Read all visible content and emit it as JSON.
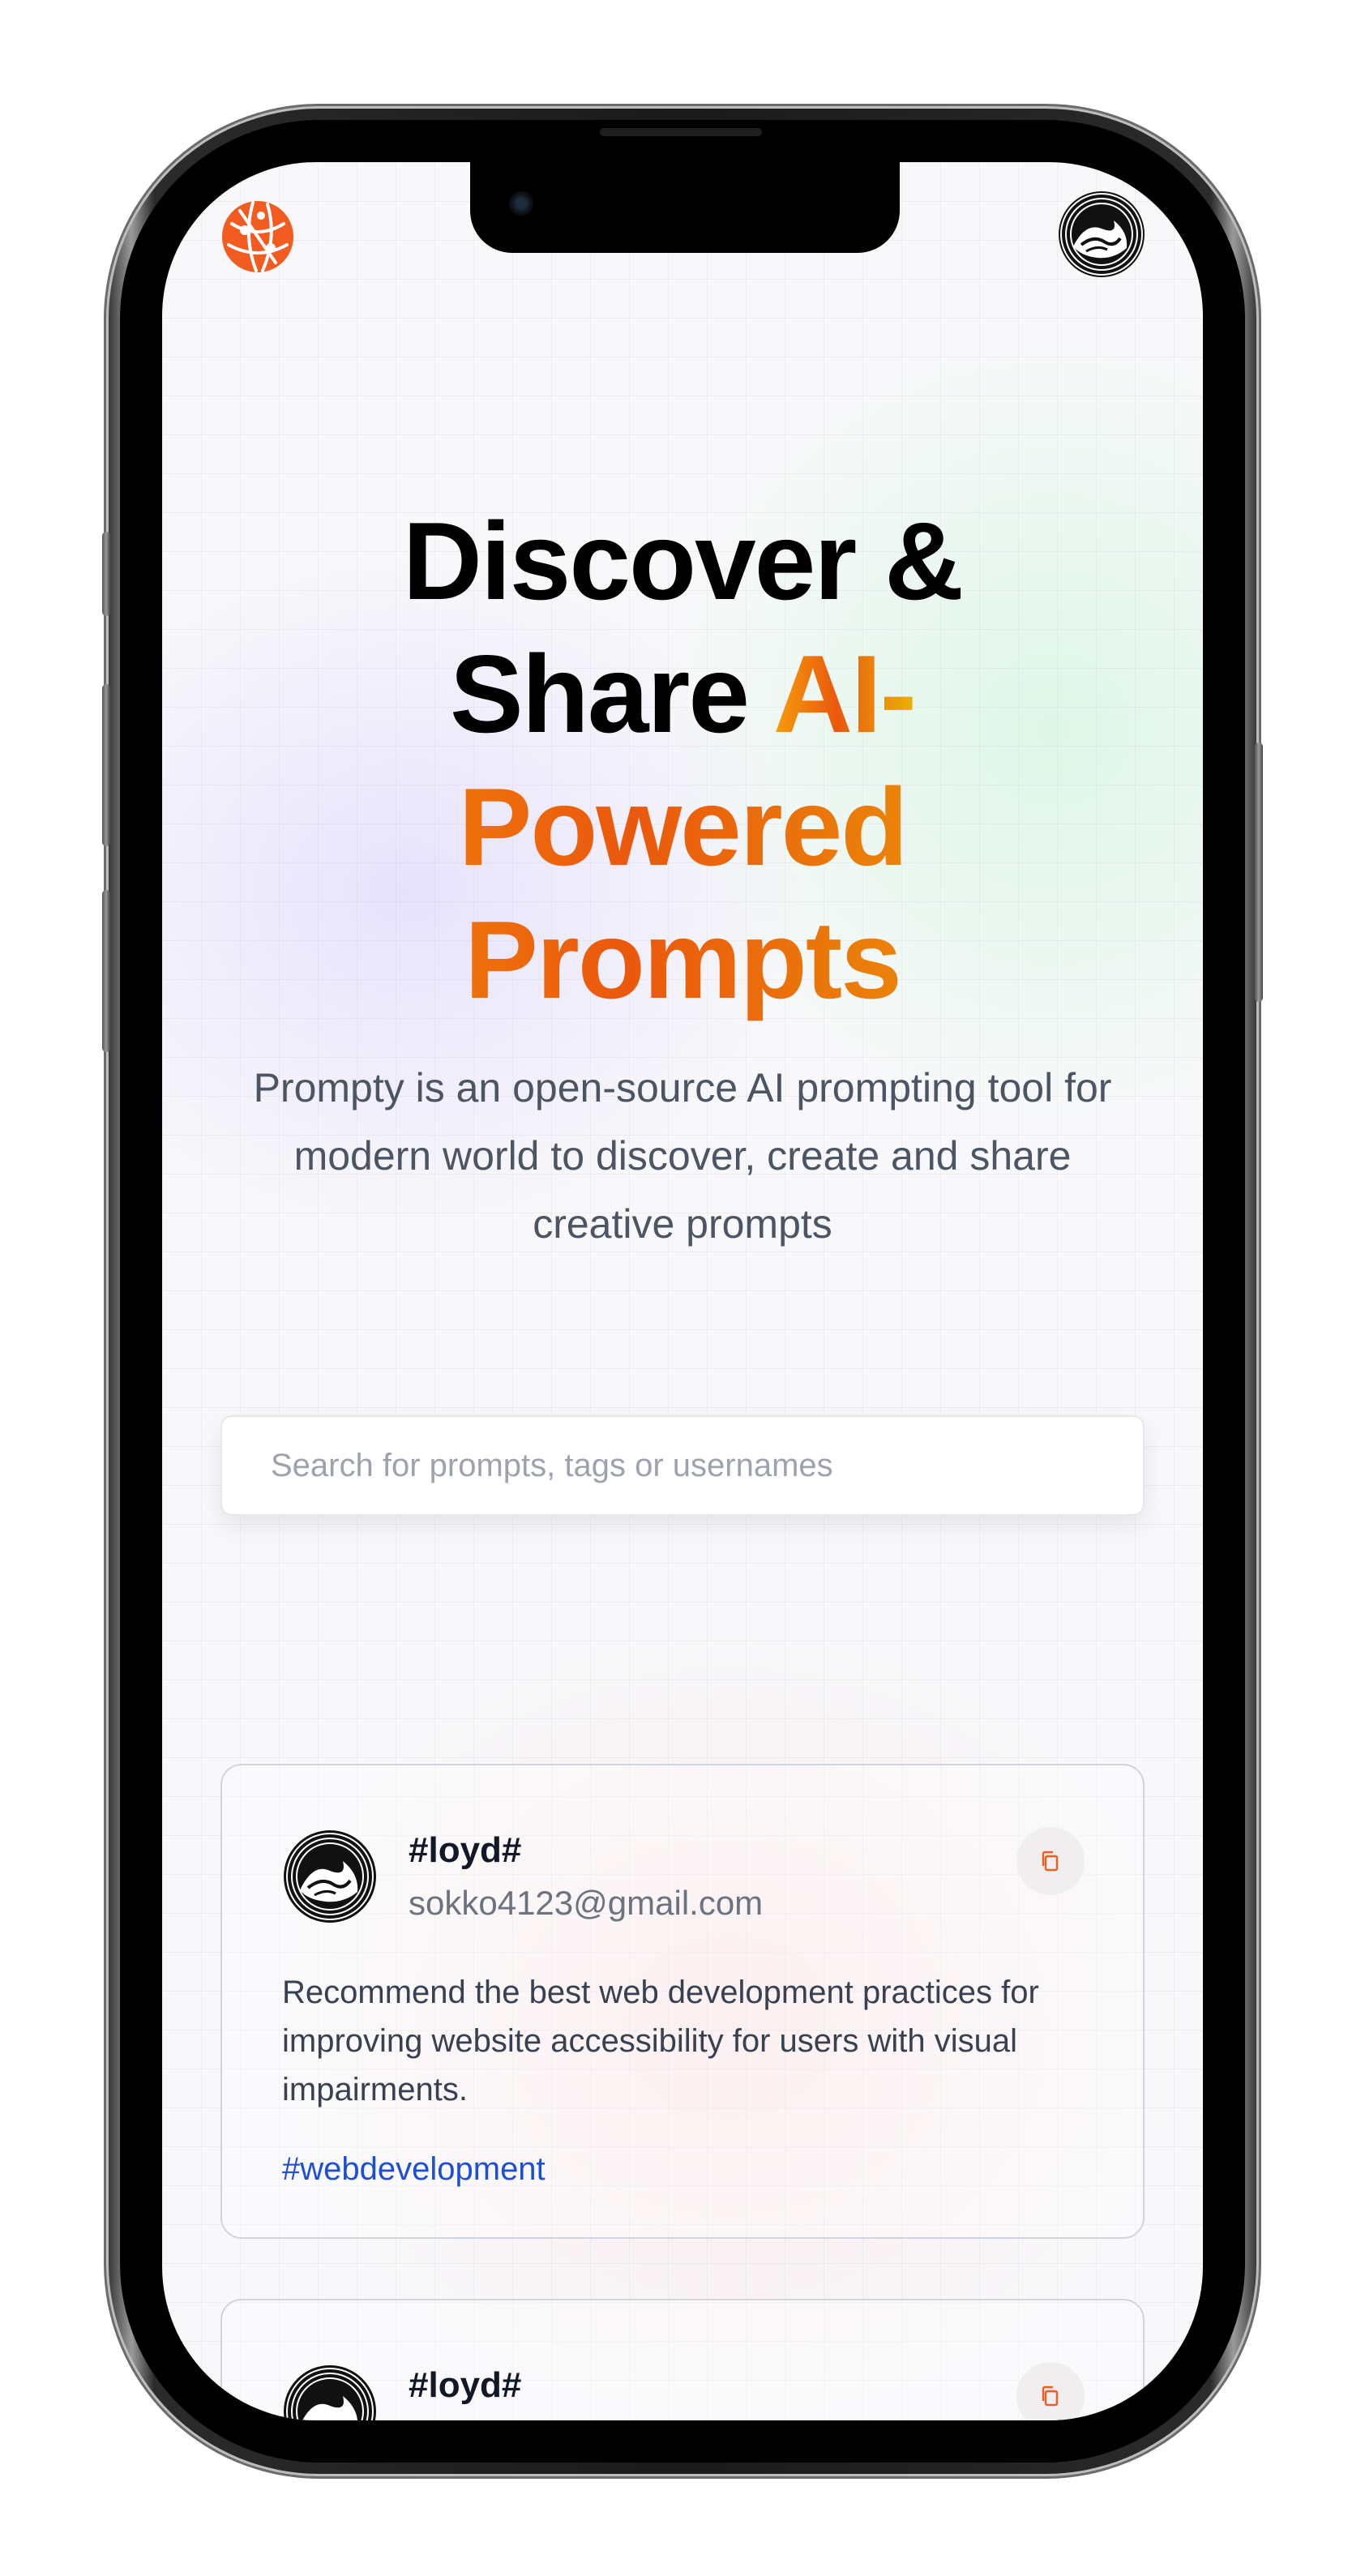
{
  "header": {
    "logo_icon": "globe-network-icon",
    "avatar_icon": "wave-avatar-icon",
    "accent_color": "#f25c21"
  },
  "hero": {
    "title_line1": "Discover &",
    "title_line2_plain": "Share ",
    "title_line2_accent": "AI-",
    "title_line3_accent": "Powered",
    "title_line4_accent": "Prompts",
    "description": "Prompty is an open-source AI prompting tool for modern world to discover, create and share creative prompts"
  },
  "search": {
    "placeholder": "Search for prompts, tags or usernames",
    "value": ""
  },
  "cards": [
    {
      "username": "#loyd#",
      "email": "sokko4123@gmail.com",
      "prompt": "Recommend the best web development practices for improving website accessibility for users with visual impairments.",
      "tag": "#webdevelopment",
      "copy_icon": "copy-icon"
    },
    {
      "username": "#loyd#",
      "copy_icon": "copy-icon"
    }
  ]
}
